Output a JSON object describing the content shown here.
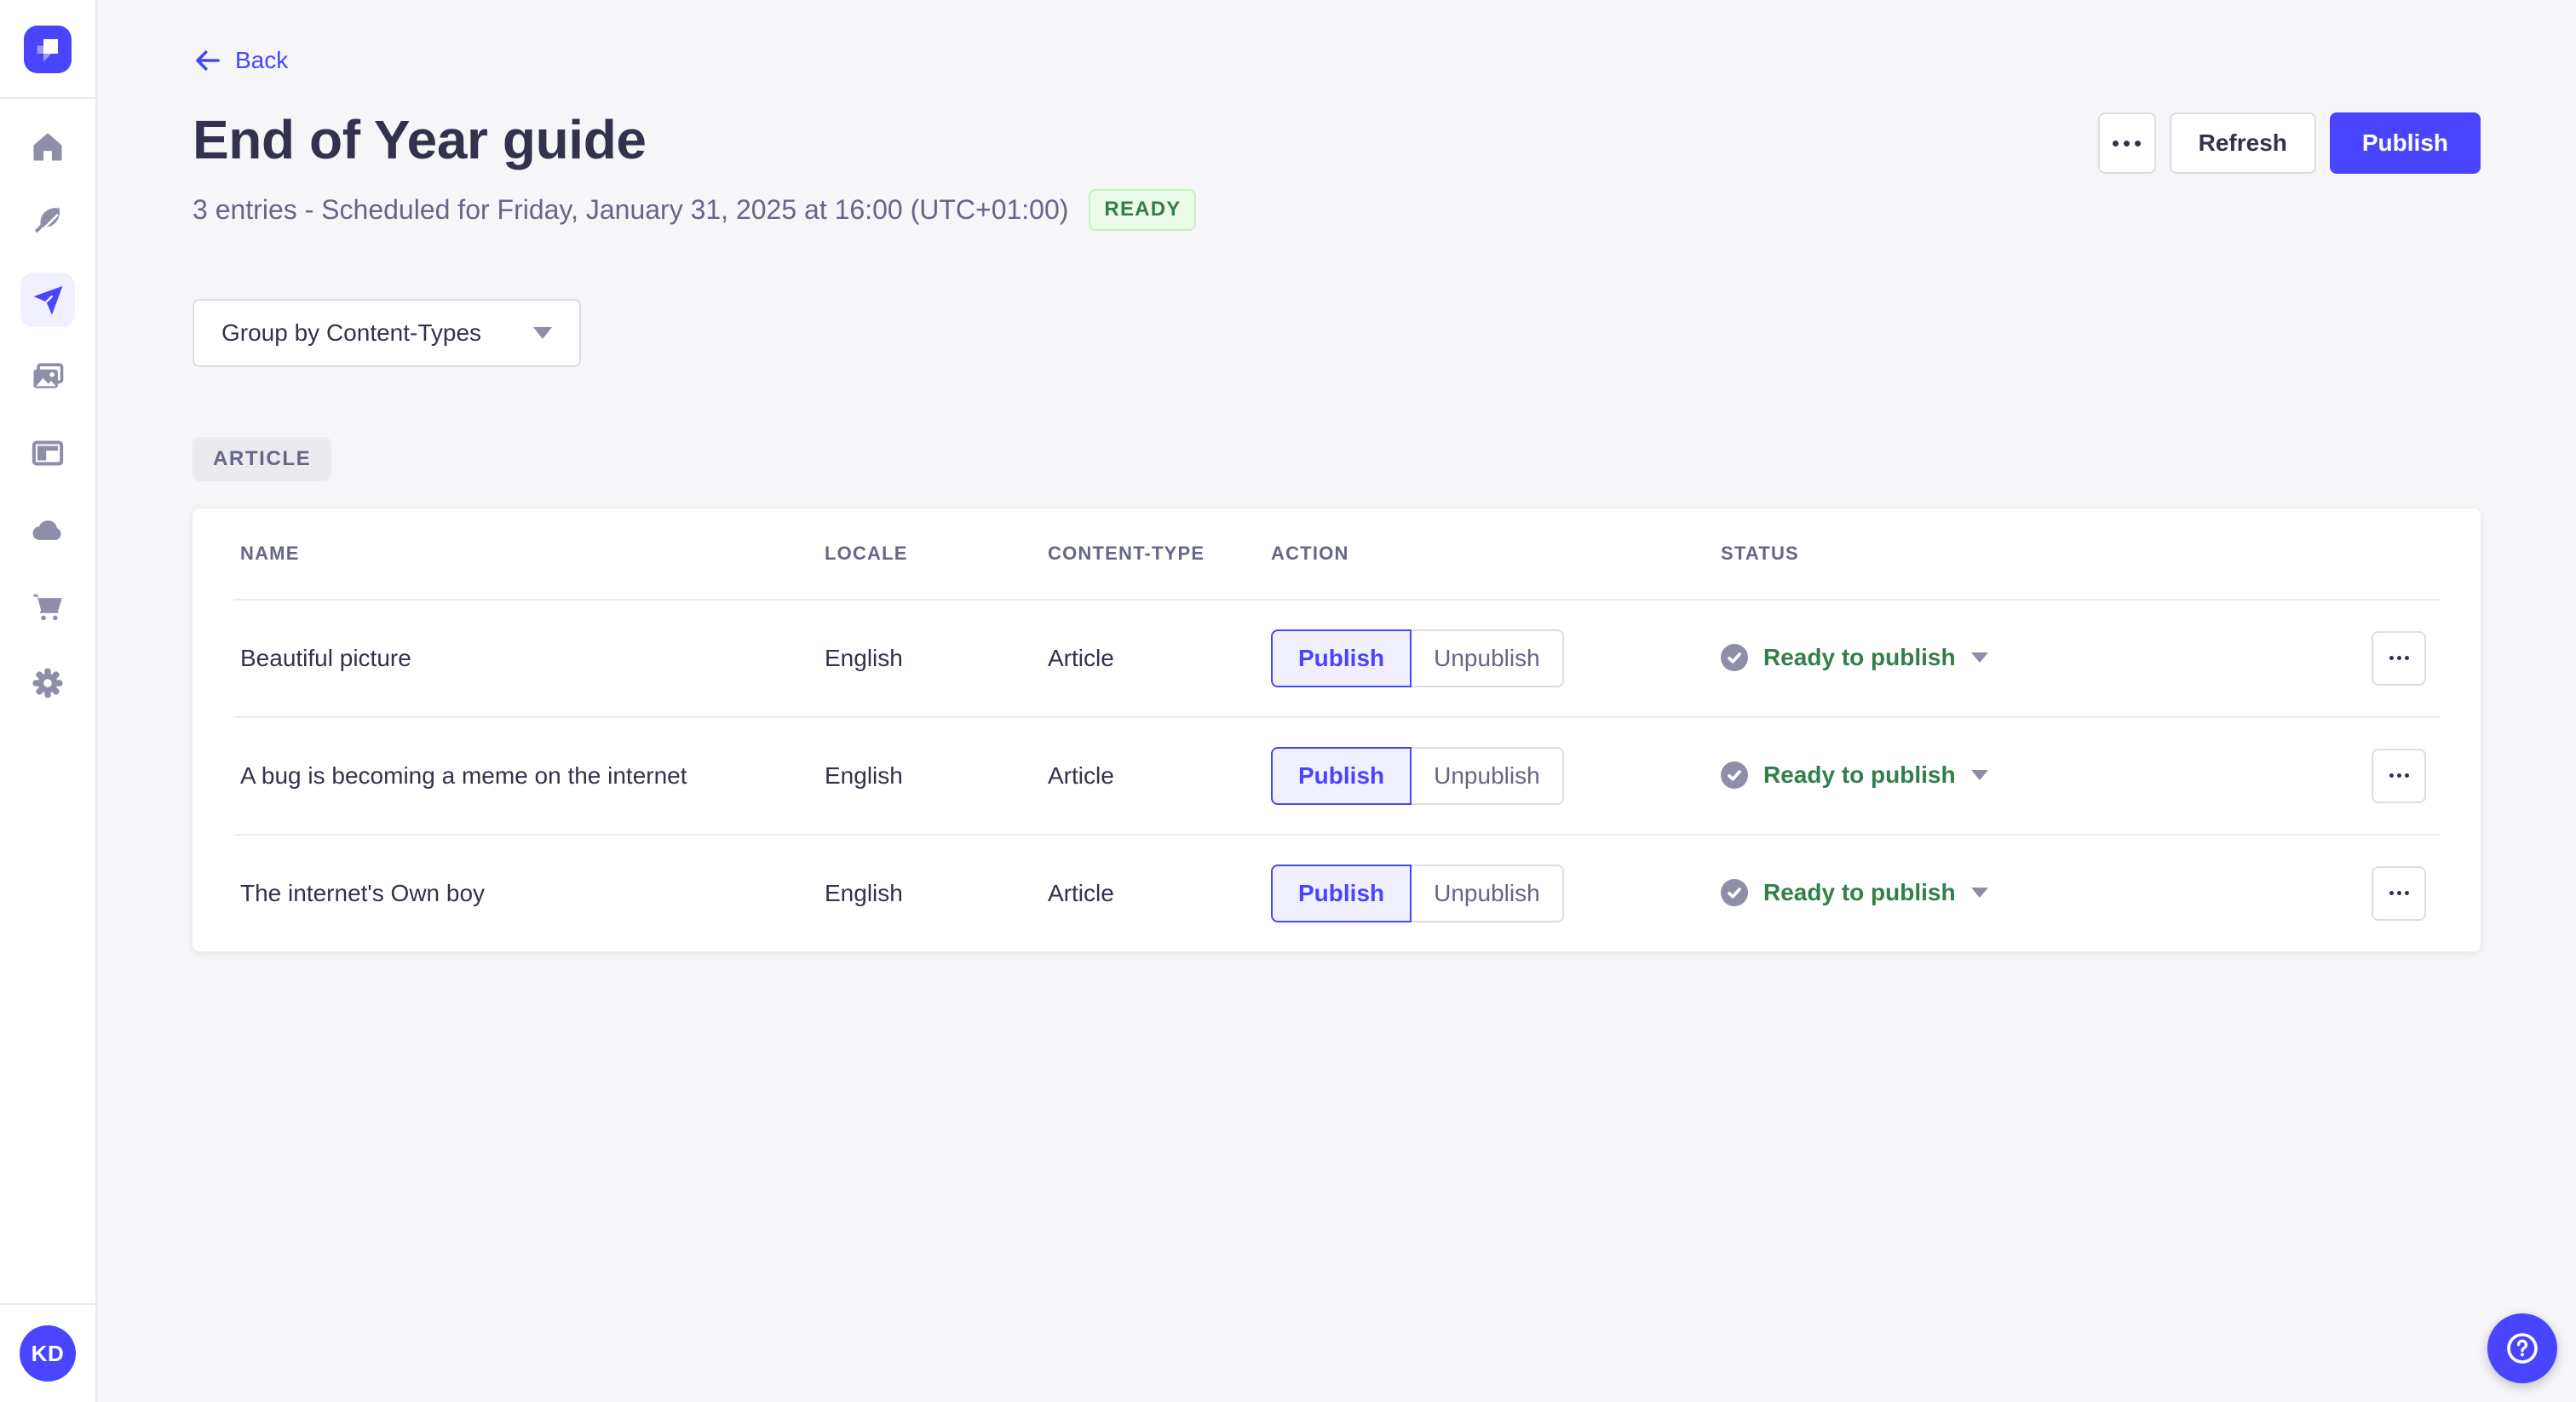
{
  "colors": {
    "accent": "#4945ff",
    "accent_light_bg": "#f0f0ff",
    "page_bg": "#f6f6f9",
    "border": "#dcdce4",
    "divider": "#eaeaef",
    "text_primary": "#32324d",
    "text_secondary": "#666687",
    "icon_gray": "#8e8ea9",
    "success_text": "#328048",
    "success_bg": "#eafbe7",
    "success_border": "#c6f0c2"
  },
  "sidebar": {
    "logo_icon": "strapi-logo",
    "items": [
      {
        "id": "home",
        "icon": "home-icon",
        "active": false
      },
      {
        "id": "content-manager",
        "icon": "feather-icon",
        "active": false
      },
      {
        "id": "releases",
        "icon": "paper-plane-icon",
        "active": true
      },
      {
        "id": "media-library",
        "icon": "media-icon",
        "active": false
      },
      {
        "id": "content-type-builder",
        "icon": "layout-icon",
        "active": false
      },
      {
        "id": "cloud",
        "icon": "cloud-icon",
        "active": false
      },
      {
        "id": "marketplace",
        "icon": "cart-icon",
        "active": false
      },
      {
        "id": "settings",
        "icon": "gear-icon",
        "active": false
      }
    ],
    "user_initials": "KD"
  },
  "header": {
    "back_label": "Back",
    "title": "End of Year guide",
    "subtitle": "3 entries - Scheduled for Friday, January 31, 2025 at 16:00 (UTC+01:00)",
    "status_badge": "READY",
    "more_icon": "ellipsis-icon",
    "refresh_label": "Refresh",
    "publish_label": "Publish"
  },
  "toolbar": {
    "group_by_label": "Group by Content-Types",
    "caret_icon": "chevron-down-icon"
  },
  "group": {
    "label": "ARTICLE"
  },
  "table": {
    "columns": [
      "NAME",
      "LOCALE",
      "CONTENT-TYPE",
      "ACTION",
      "STATUS"
    ],
    "action_buttons": {
      "publish": "Publish",
      "unpublish": "Unpublish"
    },
    "status_icon": "check-icon",
    "rows": [
      {
        "name": "Beautiful picture",
        "locale": "English",
        "content_type": "Article",
        "selected_action": "Publish",
        "status": "Ready to publish"
      },
      {
        "name": "A bug is becoming a meme on the internet",
        "locale": "English",
        "content_type": "Article",
        "selected_action": "Publish",
        "status": "Ready to publish"
      },
      {
        "name": "The internet's Own boy",
        "locale": "English",
        "content_type": "Article",
        "selected_action": "Publish",
        "status": "Ready to publish"
      }
    ]
  },
  "help": {
    "icon": "question-icon"
  }
}
